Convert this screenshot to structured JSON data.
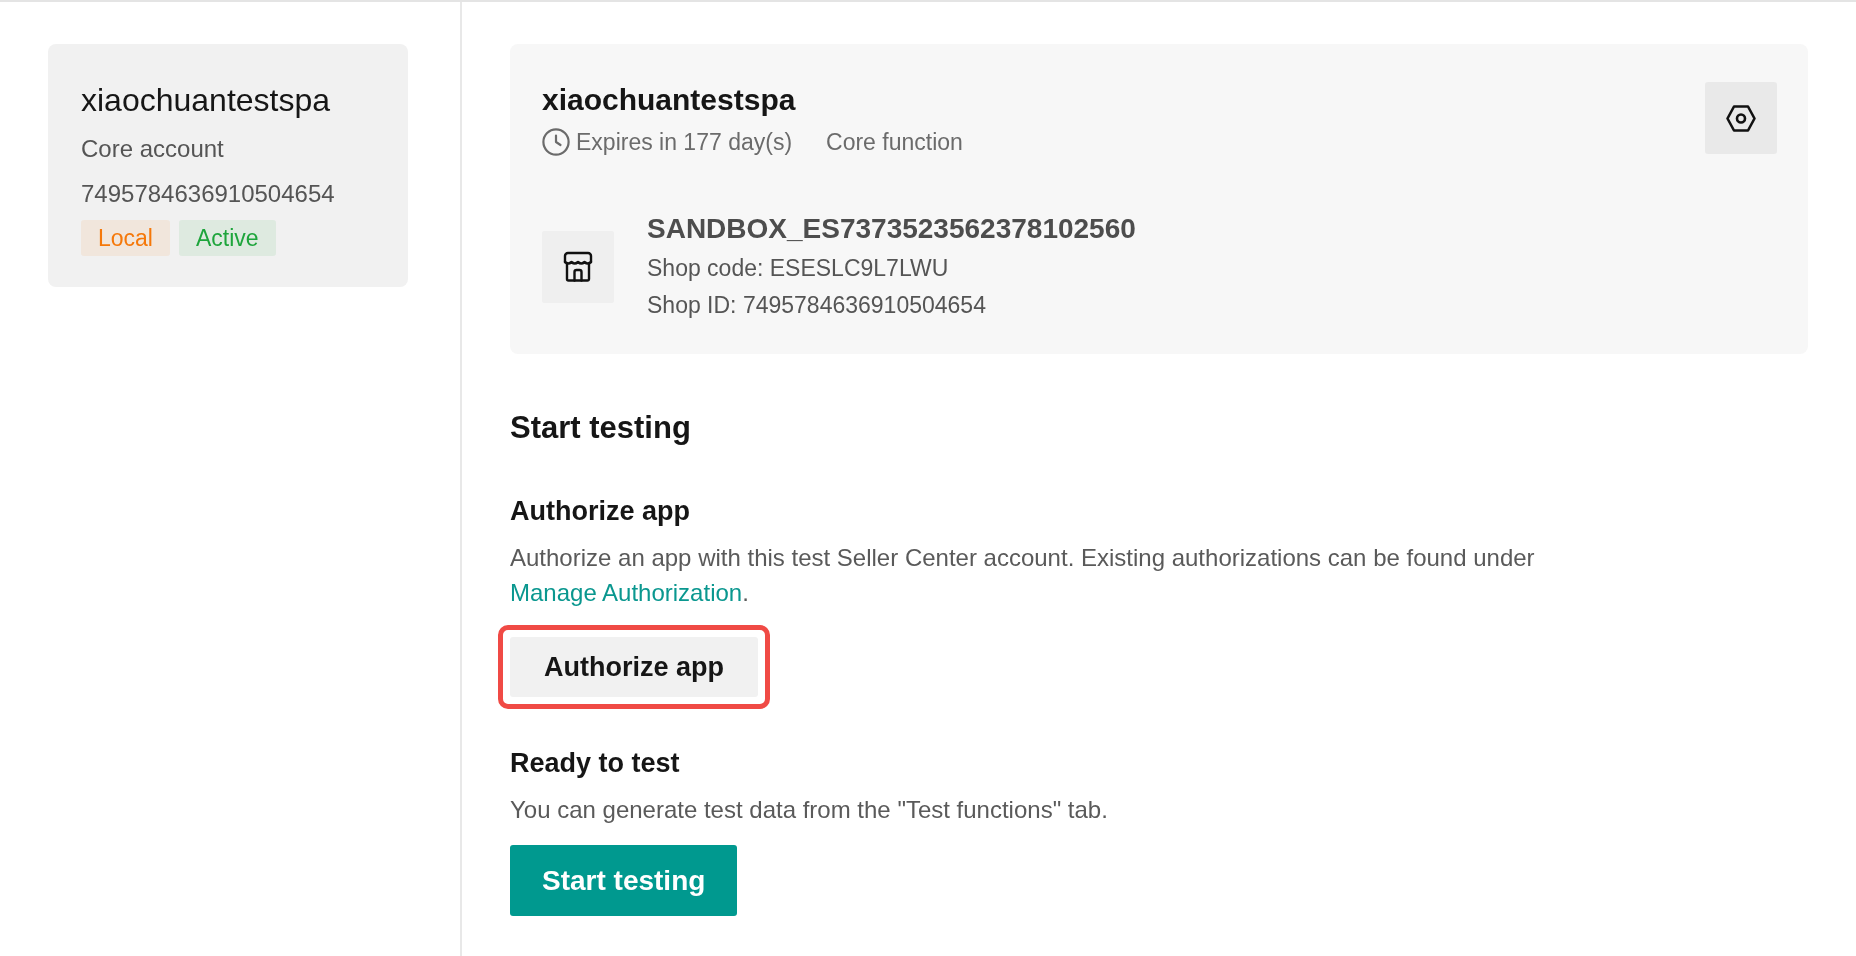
{
  "account_card": {
    "name": "xiaochuantestspa",
    "type": "Core account",
    "id": "7495784636910504654",
    "tags": [
      {
        "label": "Local",
        "color": "#f5780a"
      },
      {
        "label": "Active",
        "color": "#1ea53c"
      }
    ]
  },
  "shop_card": {
    "title": "xiaochuantestspa",
    "expiry": "Expires in 177 day(s)",
    "plan": "Core function",
    "shop": {
      "name": "SANDBOX_ES7373523562378102560",
      "code": "Shop code: ESESLC9L7LWU",
      "id": "Shop ID: 7495784636910504654"
    }
  },
  "start_testing": {
    "heading": "Start testing",
    "sections": [
      {
        "heading": "Authorize app",
        "text": "Authorize an app with this test Seller Center account. Existing authorizations can be found under ",
        "link": "Manage Authorization",
        "text_after": ".",
        "button": {
          "label": "Authorize app",
          "kind": "secondary",
          "highlighted": true
        }
      },
      {
        "heading": "Ready to test",
        "text": "You can generate test data from the \"Test functions\" tab.",
        "button": {
          "label": "Start testing",
          "kind": "primary",
          "highlighted": false
        }
      }
    ]
  }
}
